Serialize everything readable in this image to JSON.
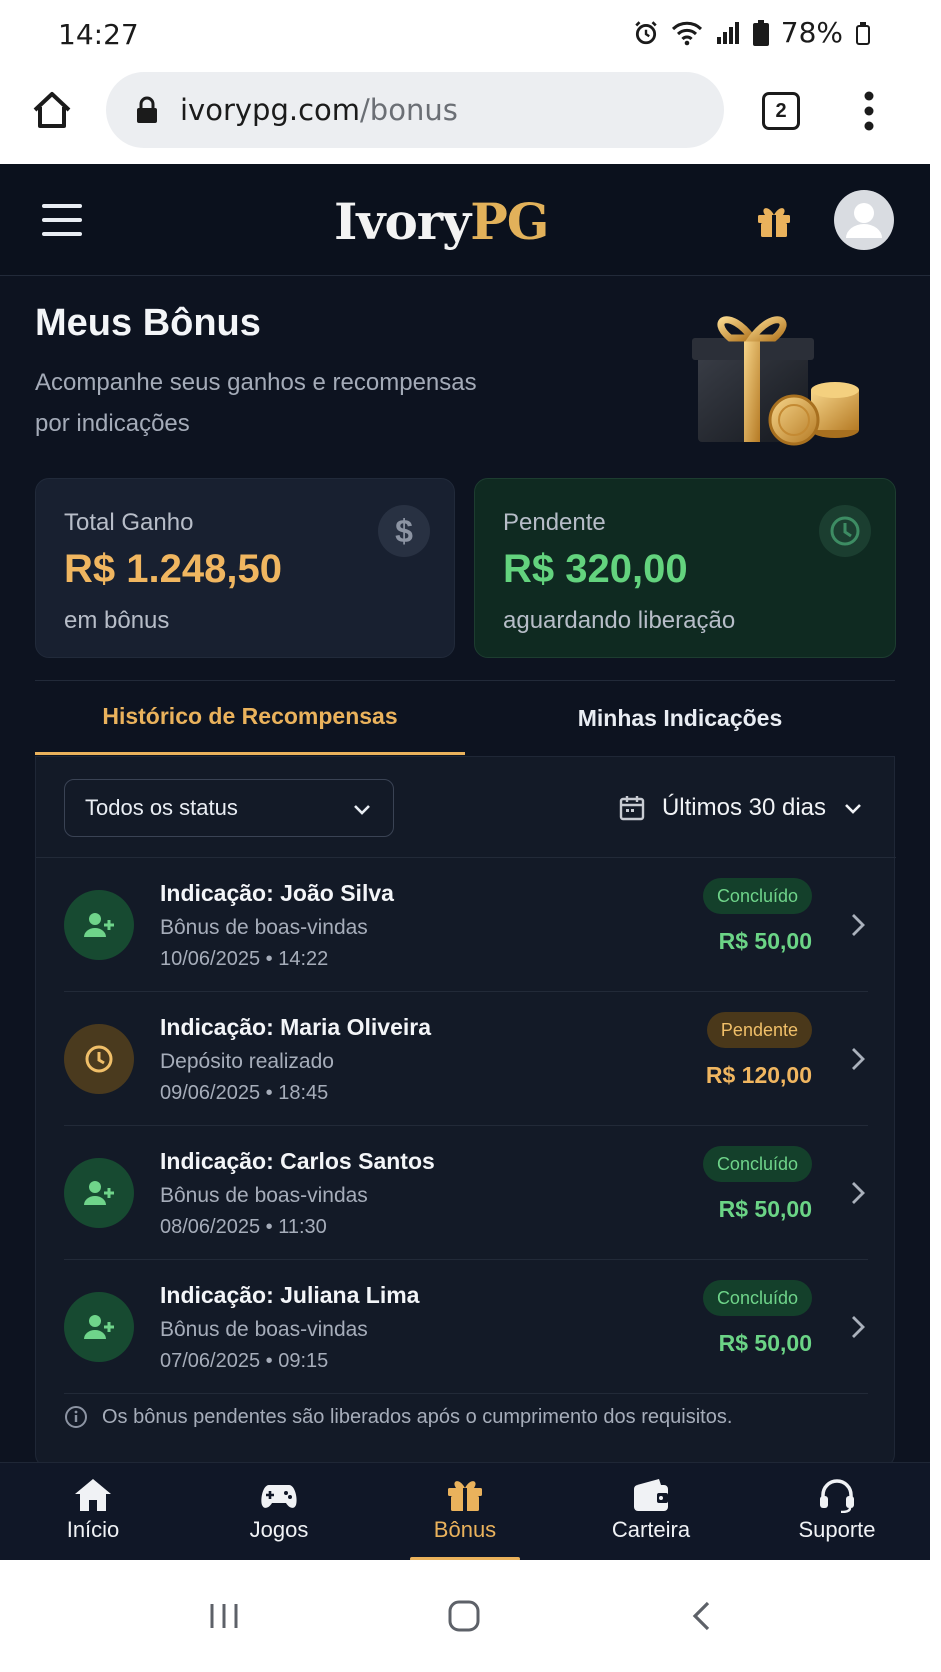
{
  "status_bar": {
    "time": "14:27",
    "battery": "78%"
  },
  "browser": {
    "domain": "ivorypg.com",
    "path": "/bonus",
    "tab_count": "2"
  },
  "header": {
    "logo_part1": "Ivory",
    "logo_part2": "PG"
  },
  "page": {
    "title": "Meus Bônus",
    "subtitle": "Acompanhe seus ganhos e recompensas por indicações"
  },
  "cards": {
    "total": {
      "label": "Total Ganho",
      "value": "R$ 1.248,50",
      "note": "em bônus",
      "icon": "$"
    },
    "pending": {
      "label": "Pendente",
      "value": "R$ 320,00",
      "note": "aguardando liberação"
    }
  },
  "tabs": {
    "history": "Histórico de Recompensas",
    "referrals": "Minhas Indicações"
  },
  "filters": {
    "status": "Todos os status",
    "period": "Últimos 30 dias"
  },
  "rows": [
    {
      "title": "Indicação: João Silva",
      "subtitle": "Bônus de boas-vindas",
      "date": "10/06/2025  •  14:22",
      "badge": "Concluído",
      "amount": "R$ 50,00",
      "status": "done",
      "icon": "user-plus-icon"
    },
    {
      "title": "Indicação: Maria Oliveira",
      "subtitle": "Depósito realizado",
      "date": "09/06/2025  •  18:45",
      "badge": "Pendente",
      "amount": "R$ 120,00",
      "status": "pending",
      "icon": "clock-icon"
    },
    {
      "title": "Indicação: Carlos Santos",
      "subtitle": "Bônus de boas-vindas",
      "date": "08/06/2025  •  11:30",
      "badge": "Concluído",
      "amount": "R$ 50,00",
      "status": "done",
      "icon": "user-plus-icon"
    },
    {
      "title": "Indicação: Juliana Lima",
      "subtitle": "Bônus de boas-vindas",
      "date": "07/06/2025  •  09:15",
      "badge": "Concluído",
      "amount": "R$ 50,00",
      "status": "done",
      "icon": "user-plus-icon"
    }
  ],
  "info_note": "Os bônus pendentes são liberados após o cumprimento dos requisitos.",
  "bottom_nav": [
    {
      "label": "Início",
      "icon": "home-icon"
    },
    {
      "label": "Jogos",
      "icon": "gamepad-icon"
    },
    {
      "label": "Bônus",
      "icon": "gift-icon",
      "active": true
    },
    {
      "label": "Carteira",
      "icon": "wallet-icon"
    },
    {
      "label": "Suporte",
      "icon": "headset-icon"
    }
  ],
  "colors": {
    "accent": "#eab25c",
    "success": "#63d37e",
    "background": "#0d1320"
  }
}
